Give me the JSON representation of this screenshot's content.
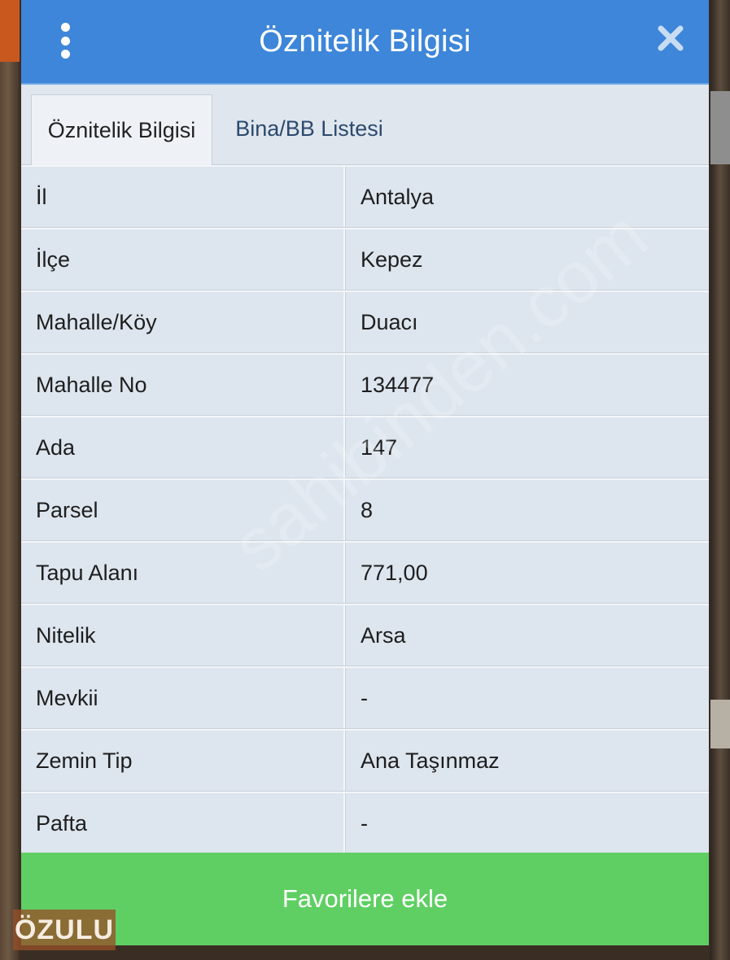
{
  "dialog": {
    "title": "Öznitelik Bilgisi",
    "menu_icon": "kebab-menu-icon",
    "close_icon": "close-icon"
  },
  "tabs": [
    {
      "label": "Öznitelik Bilgisi",
      "active": true
    },
    {
      "label": "Bina/BB Listesi",
      "active": false
    }
  ],
  "attributes": [
    {
      "label": "İl",
      "value": "Antalya"
    },
    {
      "label": "İlçe",
      "value": "Kepez"
    },
    {
      "label": "Mahalle/Köy",
      "value": "Duacı"
    },
    {
      "label": "Mahalle No",
      "value": "134477"
    },
    {
      "label": "Ada",
      "value": "147"
    },
    {
      "label": "Parsel",
      "value": "8"
    },
    {
      "label": "Tapu Alanı",
      "value": "771,00"
    },
    {
      "label": "Nitelik",
      "value": "Arsa"
    },
    {
      "label": "Mevkii",
      "value": "-"
    },
    {
      "label": "Zemin Tip",
      "value": "Ana Taşınmaz"
    },
    {
      "label": "Pafta",
      "value": "-"
    }
  ],
  "favorite_button": "Favorilere ekle",
  "watermark": "sahibinden.com",
  "logo": "ÖZULU",
  "colors": {
    "header": "#3d86d9",
    "button": "#5fcf63",
    "table_bg": "#dde5ee"
  }
}
